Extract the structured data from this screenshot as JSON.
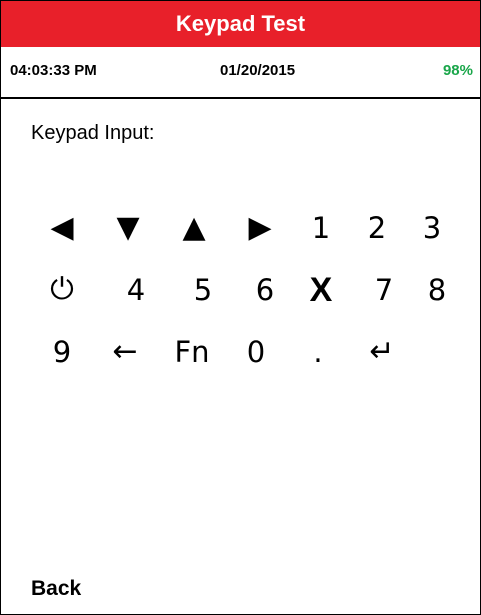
{
  "title": "Keypad Test",
  "status": {
    "time": "04:03:33 PM",
    "date": "01/20/2015",
    "battery": "98%"
  },
  "input_label": "Keypad Input:",
  "keys": {
    "left": "◀",
    "down": "▼",
    "up": "▲",
    "right": "▶",
    "k1": "1",
    "k2": "2",
    "k3": "3",
    "power": "⏻",
    "k4": "4",
    "k5": "5",
    "k6": "6",
    "x": "X",
    "k7": "7",
    "k8": "8",
    "k9": "9",
    "backspace": "←",
    "fn": "Fn",
    "k0": "0",
    "dot": ".",
    "enter": "↵"
  },
  "back_label": "Back",
  "colors": {
    "title_bg": "#e8202a",
    "battery": "#1aa64a"
  }
}
